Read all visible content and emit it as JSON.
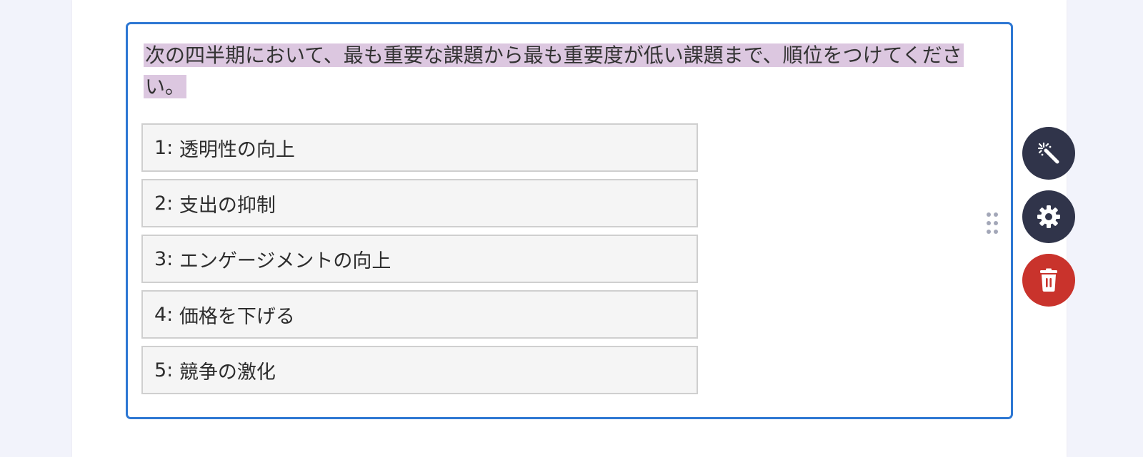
{
  "question": {
    "text": "次の四半期において、最も重要な課題から最も重要度が低い課題まで、順位をつけてください。"
  },
  "ranking": {
    "items": [
      {
        "rank": "1:",
        "label": "透明性の向上"
      },
      {
        "rank": "2:",
        "label": "支出の抑制"
      },
      {
        "rank": "3:",
        "label": "エンゲージメントの向上"
      },
      {
        "rank": "4:",
        "label": "価格を下げる"
      },
      {
        "rank": "5:",
        "label": "競争の激化"
      }
    ]
  },
  "toolbar": {
    "icons": [
      "magic-wand-icon",
      "gear-icon",
      "trash-icon"
    ],
    "dark_color": "#30344a",
    "delete_color": "#c9332c"
  },
  "theme": {
    "selection_border": "#2d77d3",
    "text_highlight": "#dcc7e0"
  }
}
